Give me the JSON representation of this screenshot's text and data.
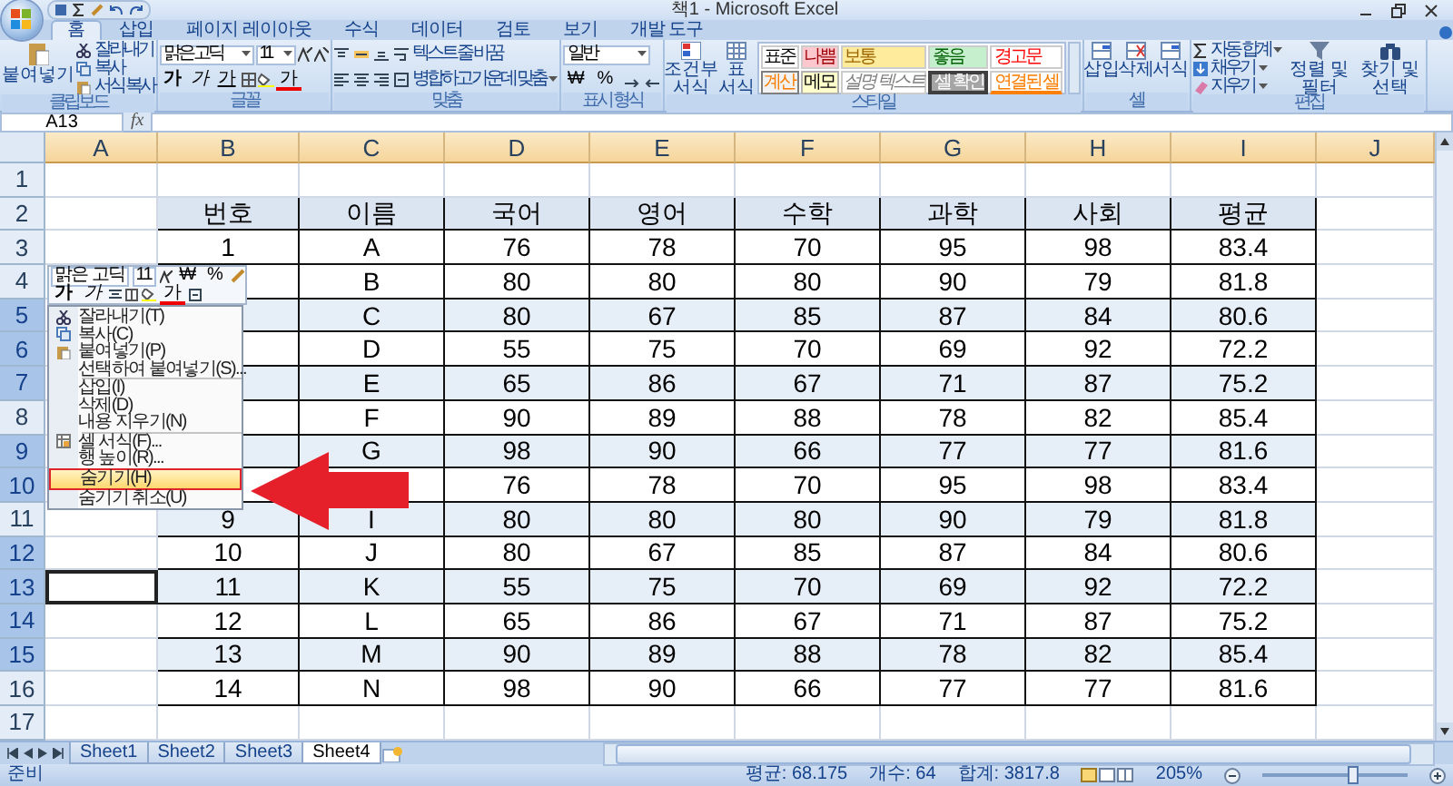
{
  "window": {
    "title": "책1 - Microsoft Excel"
  },
  "ribbon": {
    "tabs": [
      {
        "label": "홈",
        "selected": true
      },
      {
        "label": "삽입",
        "selected": false
      },
      {
        "label": "페이지 레이아웃",
        "selected": false
      },
      {
        "label": "수식",
        "selected": false
      },
      {
        "label": "데이터",
        "selected": false
      },
      {
        "label": "검토",
        "selected": false
      },
      {
        "label": "보기",
        "selected": false
      },
      {
        "label": "개발 도구",
        "selected": false
      }
    ],
    "clipboard": {
      "label": "클립보드",
      "paste": "붙여넣기",
      "commands": [
        "잘라내기",
        "복사",
        "서식 복사"
      ]
    },
    "font": {
      "label": "글꼴",
      "name": "맑은 고딕",
      "size": "11",
      "styles": [
        "가",
        "가",
        "가"
      ],
      "font_color": "가"
    },
    "alignment": {
      "label": "맞춤",
      "wrap": "텍스트 줄 바꿈",
      "merge": "병합하고 가운데 맞춤"
    },
    "number": {
      "label": "표시 형식",
      "format": "일반",
      "currency": "₩",
      "percent": "%"
    },
    "styles": {
      "label": "스타일",
      "conditional": "조건부 서식",
      "table": "표 서식",
      "gallery": [
        {
          "text": "표준",
          "kind": "normal"
        },
        {
          "text": "나쁨",
          "kind": "bad"
        },
        {
          "text": "보통",
          "kind": "neutral"
        },
        {
          "text": "좋음",
          "kind": "good"
        },
        {
          "text": "경고문",
          "kind": "warning"
        },
        {
          "text": "계산",
          "kind": "calc"
        },
        {
          "text": "메모",
          "kind": "note"
        },
        {
          "text": "설명 텍스트",
          "kind": "explanatory"
        },
        {
          "text": "셀 확인",
          "kind": "check"
        },
        {
          "text": "연결된 셀",
          "kind": "linked"
        }
      ]
    },
    "cells": {
      "label": "셀",
      "commands": [
        "삽입",
        "삭제",
        "서식"
      ]
    },
    "editing": {
      "label": "편집",
      "commands": [
        "자동 합계",
        "채우기",
        "지우기"
      ],
      "sort": "정렬 및 필터",
      "find": "찾기 및 선택"
    }
  },
  "formula_bar": {
    "name_box": "A13",
    "function_label": "fx"
  },
  "grid": {
    "columns": [
      "A",
      "B",
      "C",
      "D",
      "E",
      "F",
      "G",
      "H",
      "I",
      "J"
    ],
    "rows": [
      {
        "number": "1",
        "selected": false,
        "active_cell": false
      },
      {
        "number": "2",
        "selected": false,
        "active_cell": false
      },
      {
        "number": "3",
        "selected": false,
        "active_cell": false
      },
      {
        "number": "4",
        "selected": false,
        "active_cell": false
      },
      {
        "number": "5",
        "selected": true,
        "active_cell": false
      },
      {
        "number": "6",
        "selected": true,
        "active_cell": false
      },
      {
        "number": "7",
        "selected": true,
        "active_cell": false
      },
      {
        "number": "8",
        "selected": false,
        "active_cell": false
      },
      {
        "number": "9",
        "selected": true,
        "active_cell": false
      },
      {
        "number": "10",
        "selected": true,
        "active_cell": false
      },
      {
        "number": "11",
        "selected": false,
        "active_cell": false
      },
      {
        "number": "12",
        "selected": true,
        "active_cell": false
      },
      {
        "number": "13",
        "selected": true,
        "active_cell": true
      },
      {
        "number": "14",
        "selected": true,
        "active_cell": false
      },
      {
        "number": "15",
        "selected": true,
        "active_cell": false
      },
      {
        "number": "16",
        "selected": false,
        "active_cell": false
      },
      {
        "number": "17",
        "selected": false,
        "active_cell": false
      }
    ]
  },
  "table": {
    "header": [
      "번호",
      "이름",
      "국어",
      "영어",
      "수학",
      "과학",
      "사회",
      "평균"
    ],
    "rows": [
      {
        "shaded": false,
        "cells": [
          "1",
          "A",
          "76",
          "78",
          "70",
          "95",
          "98",
          "83.4"
        ]
      },
      {
        "shaded": false,
        "cells": [
          null,
          "B",
          "80",
          "80",
          "80",
          "90",
          "79",
          "81.8"
        ]
      },
      {
        "shaded": true,
        "cells": [
          null,
          "C",
          "80",
          "67",
          "85",
          "87",
          "84",
          "80.6"
        ]
      },
      {
        "shaded": false,
        "cells": [
          null,
          "D",
          "55",
          "75",
          "70",
          "69",
          "92",
          "72.2"
        ]
      },
      {
        "shaded": true,
        "cells": [
          null,
          "E",
          "65",
          "86",
          "67",
          "71",
          "87",
          "75.2"
        ]
      },
      {
        "shaded": false,
        "cells": [
          null,
          "F",
          "90",
          "89",
          "88",
          "78",
          "82",
          "85.4"
        ]
      },
      {
        "shaded": true,
        "cells": [
          null,
          "G",
          "98",
          "90",
          "66",
          "77",
          "77",
          "81.6"
        ]
      },
      {
        "shaded": false,
        "cells": [
          null,
          null,
          "76",
          "78",
          "70",
          "95",
          "98",
          "83.4"
        ]
      },
      {
        "shaded": true,
        "cells": [
          "9",
          "I",
          "80",
          "80",
          "80",
          "90",
          "79",
          "81.8"
        ]
      },
      {
        "shaded": false,
        "cells": [
          "10",
          "J",
          "80",
          "67",
          "85",
          "87",
          "84",
          "80.6"
        ]
      },
      {
        "shaded": true,
        "cells": [
          "11",
          "K",
          "55",
          "75",
          "70",
          "69",
          "92",
          "72.2"
        ]
      },
      {
        "shaded": false,
        "cells": [
          "12",
          "L",
          "65",
          "86",
          "67",
          "71",
          "87",
          "75.2"
        ]
      },
      {
        "shaded": true,
        "cells": [
          "13",
          "M",
          "90",
          "89",
          "88",
          "78",
          "82",
          "85.4"
        ]
      },
      {
        "shaded": false,
        "cells": [
          "14",
          "N",
          "98",
          "90",
          "66",
          "77",
          "77",
          "81.6"
        ]
      }
    ]
  },
  "mini_toolbar": {
    "font": "맑은 고딕",
    "size": "11",
    "currency": "₩",
    "percent": "%",
    "styles": [
      "가",
      "가"
    ],
    "font_color": "가"
  },
  "context_menu": {
    "groups": [
      [
        {
          "label": "잘라내기(T)",
          "kind": "cut",
          "selected": false
        },
        {
          "label": "복사(C)",
          "kind": "copy",
          "selected": false
        },
        {
          "label": "붙여넣기(P)",
          "kind": "paste",
          "selected": false
        },
        {
          "label": "선택하여 붙여넣기(S)...",
          "kind": "plain",
          "selected": false
        }
      ],
      [
        {
          "label": "삽입(I)",
          "kind": "plain",
          "selected": false
        },
        {
          "label": "삭제(D)",
          "kind": "plain",
          "selected": false
        },
        {
          "label": "내용 지우기(N)",
          "kind": "plain",
          "selected": false
        }
      ],
      [
        {
          "label": "셀 서식(F)...",
          "kind": "format",
          "selected": false
        },
        {
          "label": "행 높이(R)...",
          "kind": "plain",
          "selected": false
        },
        {
          "label": "숨기기(H)",
          "kind": "plain",
          "selected": true
        },
        {
          "label": "숨기기 취소(U)",
          "kind": "plain",
          "selected": false
        }
      ]
    ]
  },
  "sheet_tabs": [
    {
      "label": "Sheet1",
      "selected": false
    },
    {
      "label": "Sheet2",
      "selected": false
    },
    {
      "label": "Sheet3",
      "selected": false
    },
    {
      "label": "Sheet4",
      "selected": true
    }
  ],
  "status_bar": {
    "mode": "준비",
    "average": "평균: 68.175",
    "count": "개수: 64",
    "sum": "합계: 3817.8",
    "zoom": "205%",
    "zoom_slider": {
      "level": 0.62
    }
  }
}
